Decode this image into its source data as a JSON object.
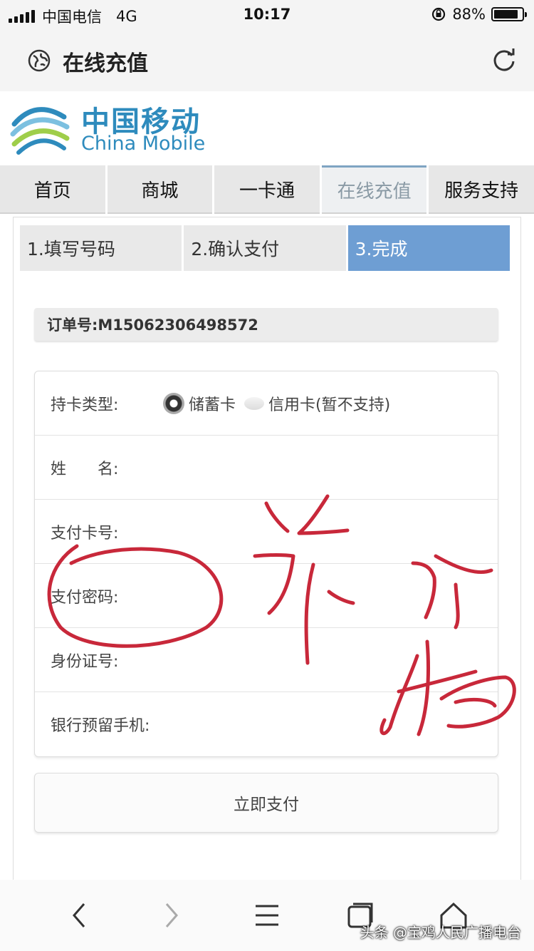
{
  "status": {
    "carrier": "中国电信",
    "network": "4G",
    "time": "10:17",
    "battery": "88%",
    "battery_level": 0.88
  },
  "browser": {
    "title": "在线充值"
  },
  "brand": {
    "name_cn": "中国移动",
    "name_en": "China Mobile",
    "color": "#2e8bbd"
  },
  "nav": {
    "tabs": [
      "首页",
      "商城",
      "一卡通",
      "在线充值",
      "服务支持"
    ],
    "active_index": 3
  },
  "steps": {
    "items": [
      "1.填写号码",
      "2.确认支付",
      "3.完成"
    ],
    "active_index": 2,
    "active_color": "#6e9ed3"
  },
  "order": {
    "label": "订单号:M15062306498572"
  },
  "form": {
    "card_type_label": "持卡类型:",
    "debit_label": "储蓄卡",
    "credit_label": "信用卡(暂不支持)",
    "name_label": "姓　　名:",
    "card_no_label": "支付卡号:",
    "password_label": "支付密码:",
    "id_label": "身份证号:",
    "phone_label": "银行预留手机:"
  },
  "pay_button": {
    "label": "立即支付"
  },
  "watermark": "头条 @宝鸡人民广播电台",
  "annotation": {
    "color": "#c8283a",
    "handwriting": "诈骗"
  }
}
